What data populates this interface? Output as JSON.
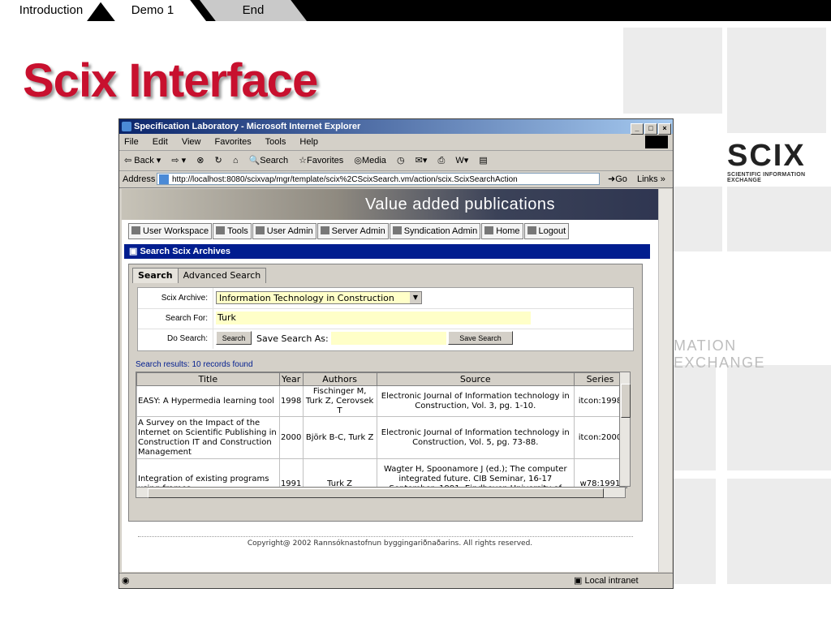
{
  "slide": {
    "nav_tabs": [
      "Introduction",
      "Demo 1",
      "End"
    ],
    "title": "Scix Interface",
    "logo_text": "SCIX",
    "logo_subtitle": "SCIENTIFIC INFORMATION EXCHANGE",
    "bg_subtitle": "MATION EXCHANGE",
    "accent_color": "#c8102e"
  },
  "browser": {
    "title": "Specification Laboratory - Microsoft Internet Explorer",
    "menu": [
      "File",
      "Edit",
      "View",
      "Favorites",
      "Tools",
      "Help"
    ],
    "toolbar": [
      "Back",
      "Search",
      "Favorites",
      "Media"
    ],
    "address_label": "Address",
    "address": "http://localhost:8080/scixvap/mgr/template/scix%2CScixSearch.vm/action/scix.ScixSearchAction",
    "go_label": "Go",
    "links_label": "Links",
    "status_zone": "Local intranet"
  },
  "page": {
    "banner": "Value added publications",
    "nav": [
      "User Workspace",
      "Tools",
      "User Admin",
      "Server Admin",
      "Syndication Admin",
      "Home",
      "Logout"
    ],
    "section_title": "Search Scix Archives",
    "tabs": [
      "Search",
      "Advanced Search"
    ],
    "form": {
      "archive_label": "Scix Archive:",
      "archive_value": "Information Technology in Construction",
      "search_for_label": "Search For:",
      "search_for_value": "Turk",
      "do_search_label": "Do Search:",
      "search_button": "Search",
      "save_as_label": "Save Search As:",
      "save_button": "Save Search"
    },
    "results_summary": "Search results: 10 records found",
    "table": {
      "headers": [
        "Title",
        "Year",
        "Authors",
        "Source",
        "Series"
      ],
      "rows": [
        {
          "title": "EASY: A Hypermedia learning tool",
          "year": "1998",
          "authors": "Fischinger M, Turk Z, Cerovsek T",
          "source": "Electronic Journal of Information technology in Construction, Vol. 3, pg. 1-10.",
          "series": "itcon:1998"
        },
        {
          "title": "A Survey on the Impact of the Internet on Scientific Publishing in Construction IT and Construction Management",
          "year": "2000",
          "authors": "Björk B-C, Turk Z",
          "source": "Electronic Journal of Information technology in Construction, Vol. 5, pg. 73-88.",
          "series": "itcon:2000"
        },
        {
          "title": "Integration of existing programs using frames",
          "year": "1991",
          "authors": "Turk Z",
          "source": "Wagter H, Spoonamore J (ed.); The computer integrated future. CIB Seminar, 16-17 September, 1991. Eindhoven University of Technology, Calibre. The",
          "series": "w78:1991"
        }
      ]
    },
    "footer": "Copyright@ 2002 Rannsóknastofnun byggingariðnaðarins. All rights reserved."
  }
}
